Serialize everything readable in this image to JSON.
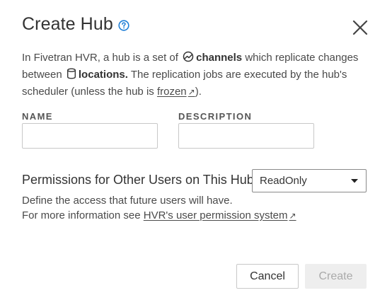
{
  "dialog": {
    "title": "Create Hub",
    "close_icon": "close-icon",
    "help_icon": "help-circle-icon"
  },
  "intro": {
    "part1": "In Fivetran HVR, a hub is a set of",
    "channels": "channels",
    "part2": "which replicate changes between",
    "locations": "locations.",
    "part3": "The replication jobs are executed by the hub's scheduler (unless the hub is",
    "frozen_link": "frozen",
    "part4": ")."
  },
  "form": {
    "name_label": "NAME",
    "name_value": "",
    "description_label": "DESCRIPTION",
    "description_value": ""
  },
  "permissions": {
    "label": "Permissions for Other Users on This Hub",
    "selected": "ReadOnly",
    "help_line1": "Define the access that future users will have.",
    "help_line2_prefix": "For more information see",
    "help_link": "HVR's user permission system"
  },
  "buttons": {
    "cancel": "Cancel",
    "create": "Create"
  },
  "colors": {
    "help_icon": "#1f7fd6",
    "text": "#3c3c3c",
    "disabled_button_bg": "#eeeeee",
    "disabled_button_text": "#aaaaaa"
  }
}
